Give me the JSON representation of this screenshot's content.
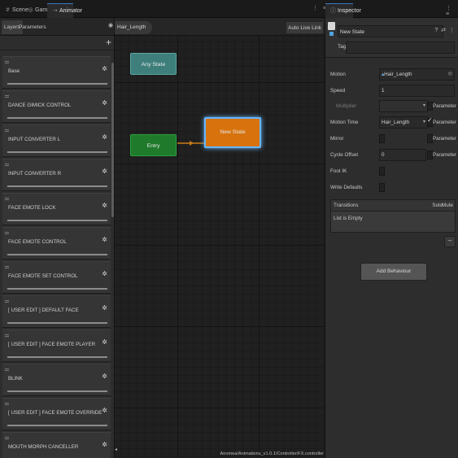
{
  "tabs": [
    {
      "icon": "#",
      "label": "Scene"
    },
    {
      "icon": "◎",
      "label": "Game"
    },
    {
      "icon": "⇢",
      "label": "Animator"
    }
  ],
  "inspector_tab": {
    "icon": "ⓘ",
    "label": "Inspector"
  },
  "tab_tools": "⋮ ≡",
  "left_panel": {
    "subtabs": [
      "Layers",
      "Parameters"
    ],
    "add_label": "+",
    "gear": "✲",
    "layers": [
      "Base",
      "DANCE GIMICK CONTROL",
      "INPUT CONVERTER L",
      "INPUT CONVERTER R",
      "FACE EMOTE LOCK",
      "FACE EMOTE CONTROL",
      "FACE EMOTE SET CONTROL",
      "[ USER EDIT ] DEFAULT FACE",
      "[ USER EDIT ] FACE EMOTE PLAYER",
      "BLINK",
      "[ USER EDIT ] FACE EMOTE OVERRIDE",
      "MOUTH MORPH CANCELLER"
    ]
  },
  "graph": {
    "eye": "◉",
    "breadcrumb": "Hair_Length",
    "auto_live_link": "Auto Live Link",
    "nodes": {
      "any_state": "Any State",
      "entry": "Entry",
      "new_state": "New State"
    },
    "footer_path": "Anomea/Animations_v1.0.1/Controller/FX.controller"
  },
  "inspector": {
    "state_name": "New State",
    "head_icons": "? ⇄ ⋮",
    "tag_label": "Tag",
    "tag_value": "",
    "motion": {
      "label": "Motion",
      "value": "Hair_Length",
      "picker": "◎"
    },
    "speed": {
      "label": "Speed",
      "value": "1"
    },
    "multiplier": {
      "label": "Multiplier",
      "value": "",
      "param": "Parameter"
    },
    "motion_time": {
      "label": "Motion Time",
      "value": "Hair_Length",
      "param": "Parameter"
    },
    "mirror": {
      "label": "Mirror",
      "param": "Parameter"
    },
    "cycle_offset": {
      "label": "Cycle Offset",
      "value": "0",
      "param": "Parameter"
    },
    "foot_ik": {
      "label": "Foot IK"
    },
    "write_defaults": {
      "label": "Write Defaults"
    },
    "transitions": {
      "header": "Transitions",
      "solo": "Solo",
      "mute": "Mute",
      "empty": "List is Empty",
      "remove": "–"
    },
    "add_behaviour": "Add Behaviour"
  },
  "colors": {
    "any_state": "#3e7f7c",
    "entry": "#1f7a2b",
    "new_state": "#d7720d",
    "selection": "#66b6ff"
  }
}
